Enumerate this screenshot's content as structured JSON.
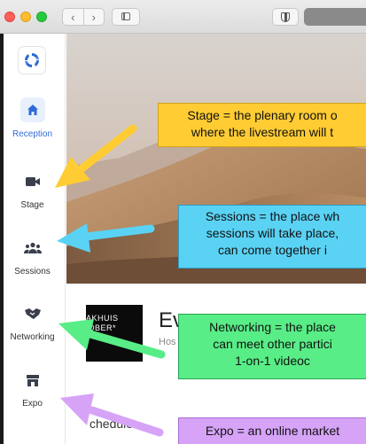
{
  "window": {
    "back_glyph": "‹",
    "forward_glyph": "›"
  },
  "sidebar": {
    "items": [
      {
        "label": "Reception",
        "icon": "home-icon",
        "active": true
      },
      {
        "label": "Stage",
        "icon": "video-camera-icon",
        "active": false
      },
      {
        "label": "Sessions",
        "icon": "people-group-icon",
        "active": false
      },
      {
        "label": "Networking",
        "icon": "handshake-icon",
        "active": false
      },
      {
        "label": "Expo",
        "icon": "storefront-icon",
        "active": false
      }
    ]
  },
  "event": {
    "title": "Ev",
    "host": "Hos",
    "logo_lines": [
      "AKHUIS",
      "/DBER*"
    ],
    "schedule_label": "chedule"
  },
  "annotations": [
    {
      "color": "#ffcc33",
      "lines": [
        "Stage = the plenary room o",
        "where the livestream will t"
      ]
    },
    {
      "color": "#5ad2f4",
      "lines": [
        "Sessions = the place wh",
        "sessions will take place,",
        "can come together i"
      ]
    },
    {
      "color": "#58ed86",
      "lines": [
        "Networking = the place",
        "can meet other partici",
        "1-on-1 videoc"
      ]
    },
    {
      "color": "#d6a3f7",
      "lines": [
        "Expo = an online market"
      ]
    }
  ],
  "colors": {
    "accent": "#2f6bd6",
    "sidebar_icon": "#3a3f4b"
  }
}
